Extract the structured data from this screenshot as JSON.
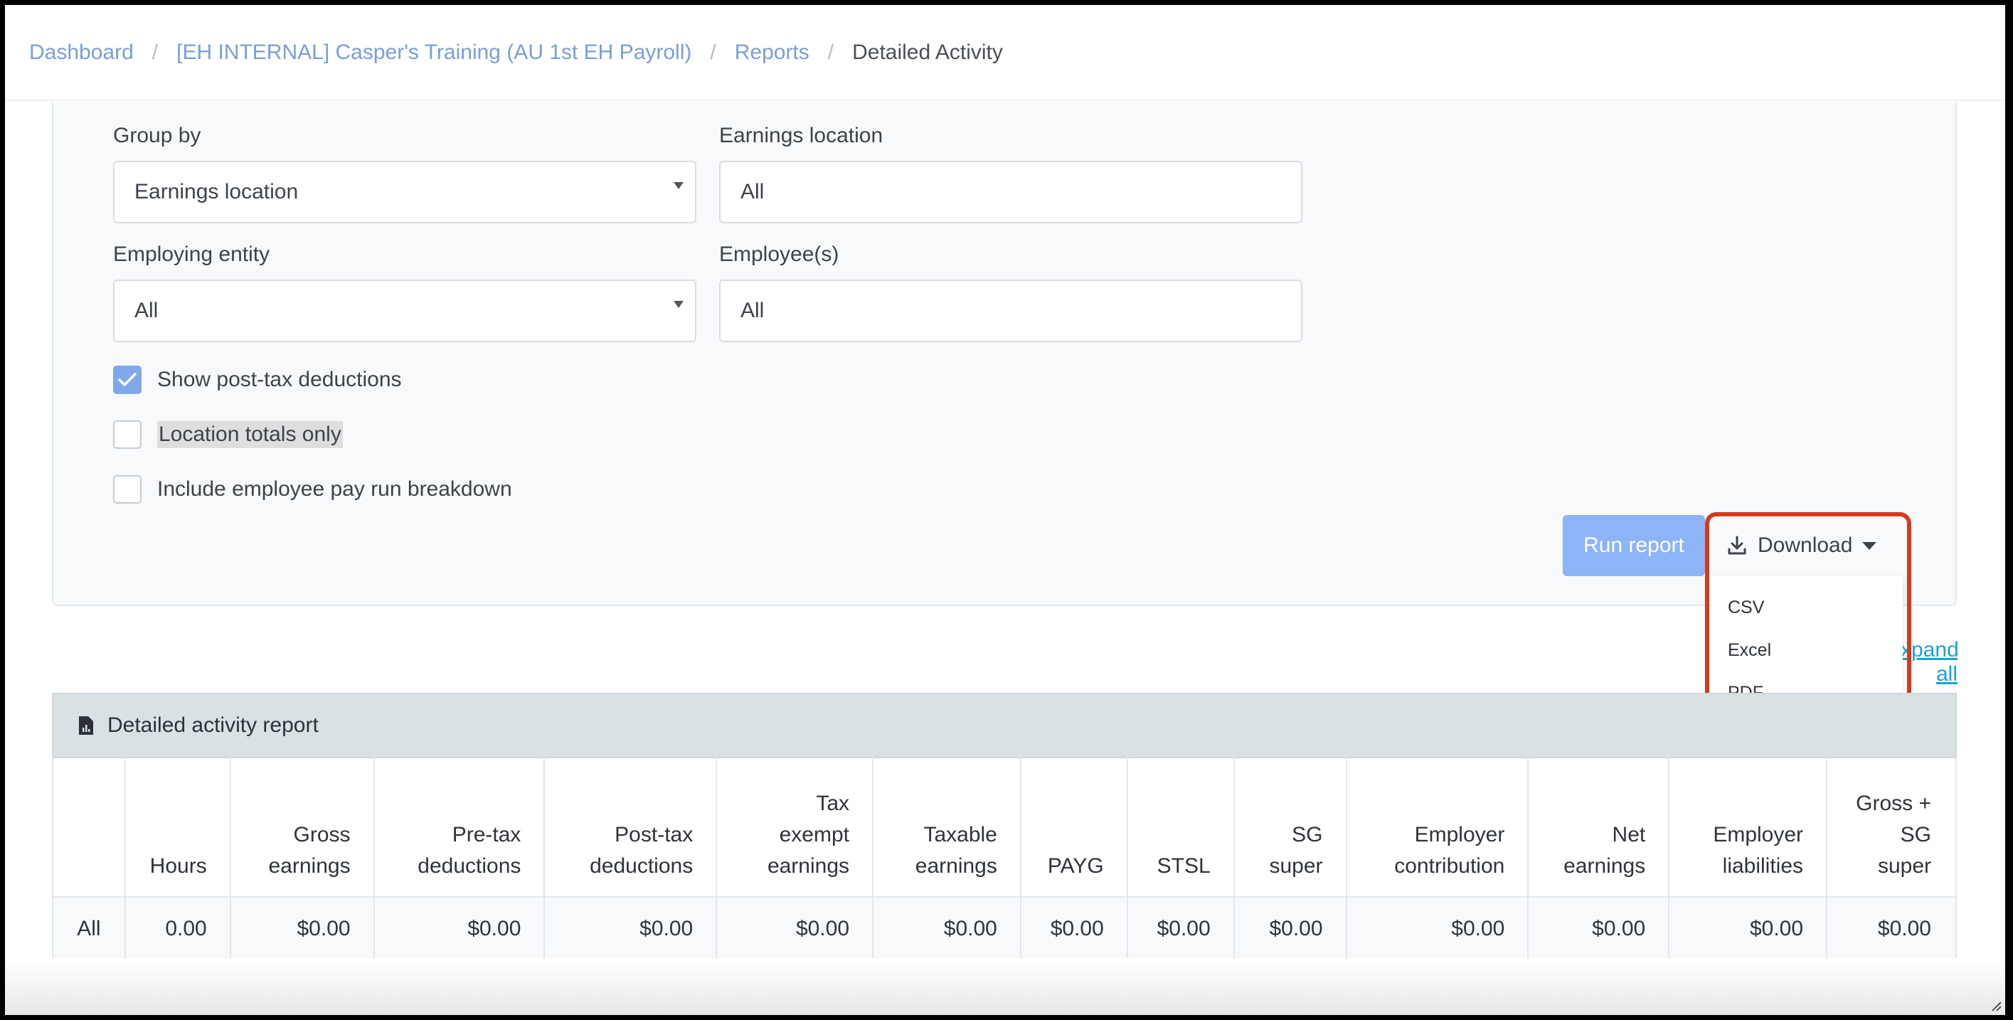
{
  "breadcrumb": {
    "items": [
      "Dashboard",
      "[EH INTERNAL] Casper's Training (AU 1st EH Payroll)",
      "Reports"
    ],
    "current": "Detailed Activity",
    "separator": "/"
  },
  "filters": {
    "group_by": {
      "label": "Group by",
      "value": "Earnings location"
    },
    "earnings_location": {
      "label": "Earnings location",
      "value": "All"
    },
    "employing_entity": {
      "label": "Employing entity",
      "value": "All"
    },
    "employees": {
      "label": "Employee(s)",
      "value": "All"
    },
    "checkboxes": [
      {
        "label": "Show post-tax deductions",
        "checked": true
      },
      {
        "label": "Location totals only",
        "checked": false
      },
      {
        "label": "Include employee pay run breakdown",
        "checked": false
      }
    ]
  },
  "actions": {
    "run_report": "Run report",
    "download": "Download",
    "download_options": [
      "CSV",
      "Excel",
      "PDF"
    ],
    "expand_all": "Expand all"
  },
  "report": {
    "title": "Detailed activity report",
    "columns": [
      "",
      "Hours",
      "Gross earnings",
      "Pre-tax deductions",
      "Post-tax deductions",
      "Tax exempt earnings",
      "Taxable earnings",
      "PAYG",
      "STSL",
      "SG super",
      "Employer contribution",
      "Net earnings",
      "Employer liabilities",
      "Gross + SG super"
    ],
    "rows": [
      [
        "All",
        "0.00",
        "$0.00",
        "$0.00",
        "$0.00",
        "$0.00",
        "$0.00",
        "$0.00",
        "$0.00",
        "$0.00",
        "$0.00",
        "$0.00",
        "$0.00",
        "$0.00"
      ]
    ]
  },
  "colors": {
    "link": "#7a9ed8",
    "primary_button": "#8db4f6",
    "highlight_outline": "#d63a1e",
    "report_header_bg": "#d9e1e5"
  }
}
